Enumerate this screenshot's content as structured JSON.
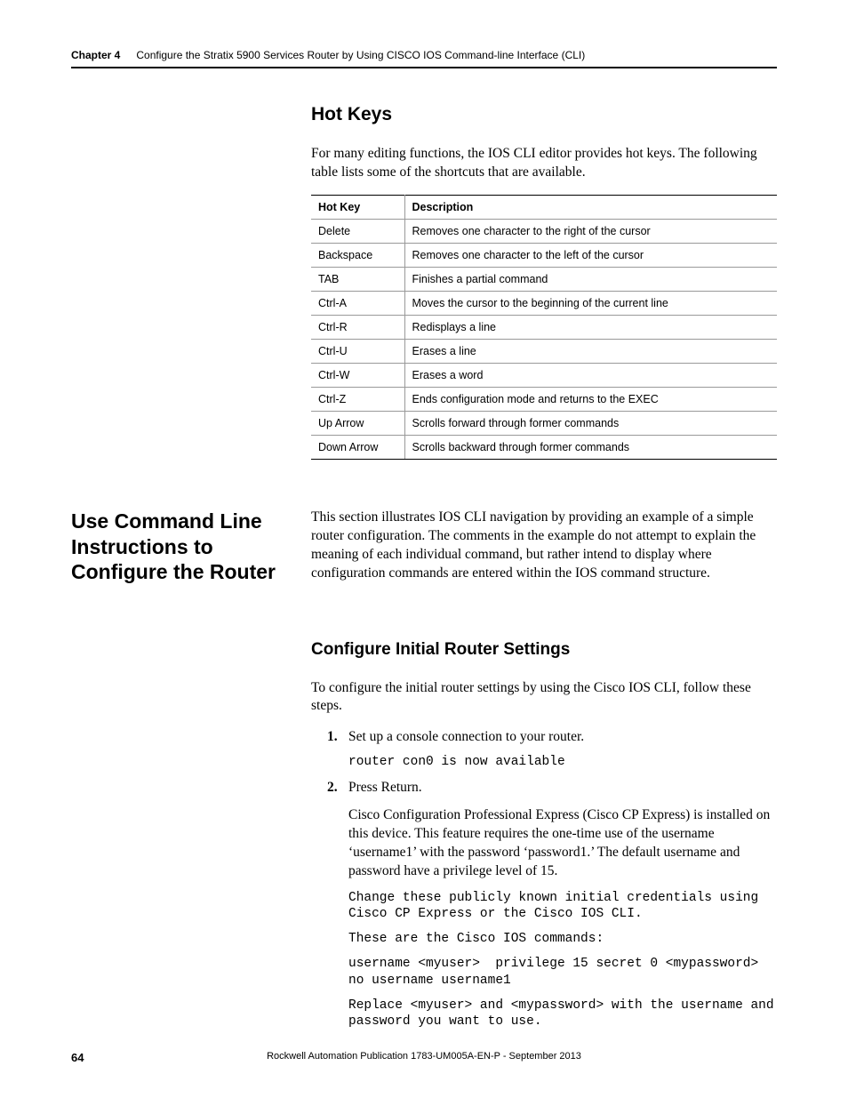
{
  "header": {
    "chapter_label": "Chapter 4",
    "chapter_title": "Configure the Stratix 5900 Services Router by Using CISCO IOS Command-line Interface (CLI)"
  },
  "hotkeys": {
    "title": "Hot Keys",
    "intro": "For many editing functions, the IOS CLI editor provides hot keys. The following table lists some of the shortcuts that are available.",
    "col_key": "Hot Key",
    "col_desc": "Description",
    "rows": [
      {
        "key": "Delete",
        "desc": "Removes one character to the right of the cursor"
      },
      {
        "key": "Backspace",
        "desc": "Removes one character to the left of the cursor"
      },
      {
        "key": "TAB",
        "desc": "Finishes a partial command"
      },
      {
        "key": "Ctrl-A",
        "desc": "Moves the cursor to the beginning of the current line"
      },
      {
        "key": "Ctrl-R",
        "desc": "Redisplays a line"
      },
      {
        "key": "Ctrl-U",
        "desc": "Erases a line"
      },
      {
        "key": "Ctrl-W",
        "desc": "Erases a word"
      },
      {
        "key": "Ctrl-Z",
        "desc": "Ends configuration mode and returns to the EXEC"
      },
      {
        "key": "Up Arrow",
        "desc": "Scrolls forward through former commands"
      },
      {
        "key": "Down Arrow",
        "desc": "Scrolls backward through former commands"
      }
    ]
  },
  "cli_section": {
    "left_title": "Use Command Line Instructions to Configure the Router",
    "intro": "This section illustrates IOS CLI navigation by providing an example of a simple router configuration. The comments in the example do not attempt to explain the meaning of each individual command, but rather intend to display where configuration commands are entered within the IOS command structure."
  },
  "configure": {
    "title": "Configure Initial Router Settings",
    "intro": "To configure the initial router settings by using the Cisco IOS CLI, follow these steps.",
    "step1": "Set up a console connection to your router.",
    "code1": "router con0 is now available",
    "step2": "Press Return.",
    "step2_para": "Cisco Configuration Professional Express (Cisco CP Express) is installed on this device. This feature requires the one-time use of the username ‘username1’ with the password ‘password1.’ The default username and password have a privilege level of 15.",
    "code2a": "Change these publicly known initial credentials using Cisco CP Express or the Cisco IOS CLI.",
    "code2b": "These are the Cisco IOS commands:",
    "code2c": "username <myuser>  privilege 15 secret 0 <mypassword>\nno username username1",
    "code2d": "Replace <myuser> and <mypassword> with the username and password you want to use."
  },
  "footer": {
    "page": "64",
    "publication": "Rockwell Automation Publication 1783-UM005A-EN-P - September 2013"
  }
}
